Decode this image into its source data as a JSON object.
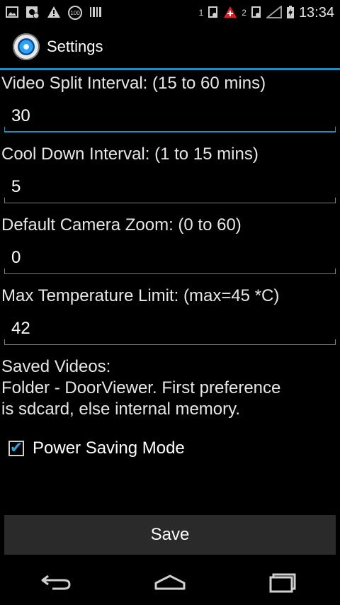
{
  "status_bar": {
    "badge_100": "100",
    "sim1": "1",
    "sim2": "2",
    "time": "13:34"
  },
  "action_bar": {
    "title": "Settings"
  },
  "settings": {
    "video_split": {
      "label": "Video Split Interval: (15 to 60 mins)",
      "value": "30"
    },
    "cool_down": {
      "label": "Cool Down Interval: (1 to 15 mins)",
      "value": "5"
    },
    "camera_zoom": {
      "label": "Default Camera Zoom: (0 to 60)",
      "value": "0"
    },
    "max_temp": {
      "label": "Max Temperature Limit: (max=45 *C)",
      "value": "42"
    },
    "saved_videos": {
      "title": "Saved Videos:",
      "line1": "Folder - DoorViewer. First preference",
      "line2": "is sdcard, else internal memory."
    },
    "power_saving": {
      "label": "Power Saving Mode",
      "checked": true
    }
  },
  "save_button": {
    "label": "Save"
  },
  "colors": {
    "accent": "#1d8fbf",
    "check": "#2ea3d6"
  }
}
